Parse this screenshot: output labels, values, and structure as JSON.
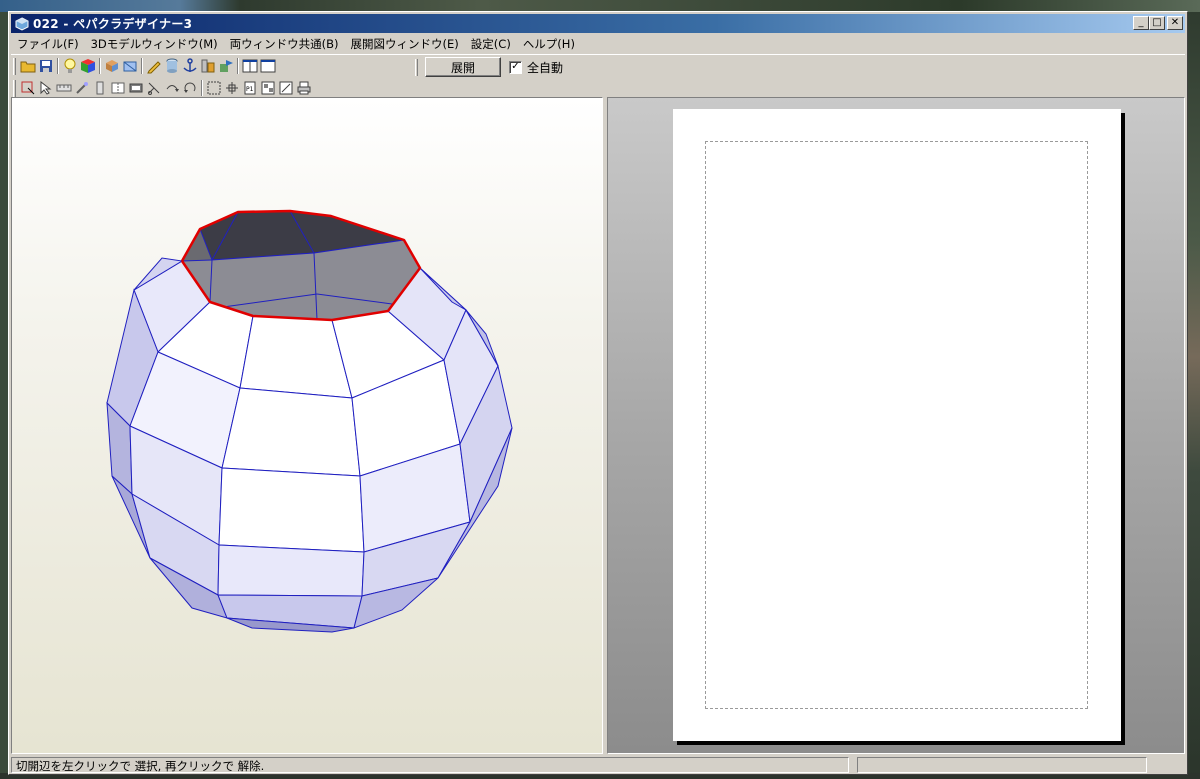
{
  "window": {
    "title": "022 - ペパクラデザイナー3"
  },
  "menu": [
    "ファイル(F)",
    "3Dモデルウィンドウ(M)",
    "両ウィンドウ共通(B)",
    "展開図ウィンドウ(E)",
    "設定(C)",
    "ヘルプ(H)"
  ],
  "toolbar": {
    "unfold_label": "展開",
    "auto_label": "全自動",
    "auto_checked": true,
    "row1_icons": [
      "open-folder-icon",
      "save-disk-icon",
      "lightbulb-icon",
      "colored-cube-icon",
      "rotate-model-icon",
      "texture-cube-icon",
      "pencil-icon",
      "cylinder-icon",
      "anchor-icon",
      "wall-icon",
      "flag-icon",
      "split-view-icon",
      "single-view-icon"
    ],
    "row2_icons": [
      "select-edge-icon",
      "pointer-icon",
      "ruler-icon",
      "magic-wand-icon",
      "flap-icon",
      "fold-icon",
      "box-icon",
      "cut-edge-icon",
      "join-edge-icon",
      "rotate-part-icon",
      "frame-select-icon",
      "move-part-icon",
      "page-icon",
      "layout-icon",
      "edit-icon",
      "printer-icon"
    ]
  },
  "status": {
    "text": "切開辺を左クリックで 選択, 再クリックで 解除."
  },
  "colors": {
    "selected_edge": "#e00000",
    "model_edge": "#2020c0",
    "face_light": "#ffffff",
    "face_shade": "#c8c8ec",
    "face_dark": "#4a4a58"
  }
}
